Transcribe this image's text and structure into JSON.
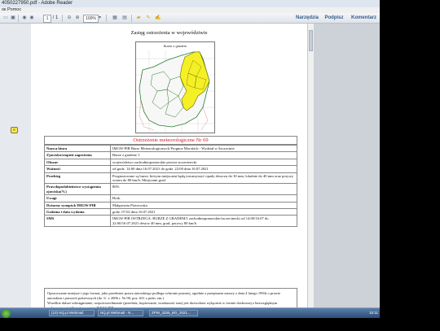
{
  "window": {
    "title": "4050227950.pdf - Adobe Reader",
    "menu": "ок Pomoc"
  },
  "toolbar": {
    "page_current": "1",
    "page_total": "/ 1",
    "zoom": "100%",
    "tabs": [
      "Narzędzia",
      "Podpisz",
      "Komentarz"
    ]
  },
  "document": {
    "map_title": "Zasięg ostrzeżenia w województwie",
    "map_label": "Burze z gradem",
    "warning_header": "Ostrzeżenie meteorologiczne Nr 69",
    "rows": [
      {
        "key": "Nazwa biura",
        "value": "IMGW-PIB Biuro Meteorologicznych Prognoz Morskich - Wydział w Szczecinie"
      },
      {
        "key": "Zjawisko/stopień zagrożenia",
        "value": "Burze z gradem/ 1"
      },
      {
        "key": "Obszar",
        "value": "województwo zachodniopomorskie powiat szczecinecki"
      },
      {
        "key": "Ważność",
        "value": "od godz. 14:00 dnia 16.07.2021 do godz. 22:00 dnia 16.07.2021"
      },
      {
        "key": "Przebieg",
        "value": "Prognozowane są burze, którym miejscami będą towarzyszyć opady deszczu do 30 mm, lokalnie do 40 mm oraz porywy wiatru do 80 km/h. Miejscami grad."
      },
      {
        "key": "Prawdopodobieństwo wystąpienia zjawiska(%)",
        "value": "80%"
      },
      {
        "key": "Uwagi",
        "value": "Brak."
      },
      {
        "key": "Dyżurny synoptyk IMGW-PIB",
        "value": "Małgorzata Piotrowska"
      },
      {
        "key": "Godzina i data wydania",
        "value": "godz. 07:02 dnia 16.07.2021"
      },
      {
        "key": "SMS",
        "value": "IMGW-PIB OSTRZEGA: BURZE Z GRADEM/1 zachodniopomorskie/szczecinecki od 14:00/16.07 do 22:00/16.07.2021 deszcz 40 mm, grad, porywy 80 km/h"
      }
    ],
    "footnote_1": "Opracowanie nniejsze i jego format, jako przedmiot prawa autorskiego podlega ochronie prawnej, zgodnie z przepisami ustawy z dnia 4 lutego 1994r o prawie autorskim i prawach pokrewnych (dz. U. z 2006 r. Nr 90, poz. 631 z późn. zm.)",
    "footnote_2": "Wszelkie dalsze udostępnianie, rozpowszechnianie (przedruk, kopiowanie, wiadomość sms) jest dozwolone wyłącznie w formie dosłownej z bezwzględnym wskazaniem źródła informacji tj. IMGW-PIB."
  },
  "taskbar": {
    "items": [
      "(10) NQ.pl Webmail",
      "NQ.pl Webmail - N...",
      "ZPW_3255_BG_2021..."
    ],
    "clock": "10:11"
  },
  "colors": {
    "warning_red": "#d21a1a",
    "area_yellow": "#f5f026",
    "taskbar_blue": "#2b4d78"
  }
}
